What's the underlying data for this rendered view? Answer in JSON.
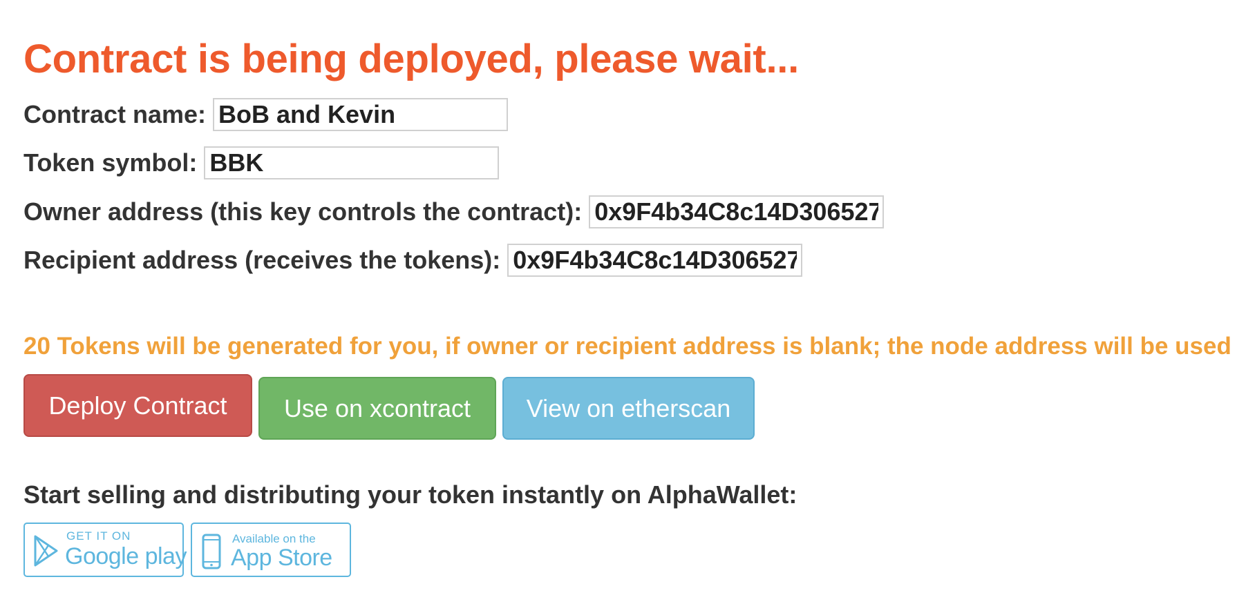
{
  "heading": "Contract is being deployed, please wait...",
  "form": {
    "contract_name_label": "Contract name:",
    "contract_name_value": "BoB and Kevin",
    "token_symbol_label": "Token symbol:",
    "token_symbol_value": "BBK",
    "owner_label": "Owner address (this key controls the contract):",
    "owner_value": "0x9F4b34C8c14D306527",
    "recipient_label": "Recipient address (receives the tokens):",
    "recipient_value": "0x9F4b34C8c14D306527"
  },
  "notice": "20 Tokens will be generated for you, if owner or recipient address is blank; the node address will be used",
  "buttons": {
    "deploy": "Deploy Contract",
    "xcontract": "Use on xcontract",
    "etherscan": "View on etherscan"
  },
  "promo": "Start selling and distributing your token instantly on AlphaWallet:",
  "badges": {
    "google_small": "GET IT ON",
    "google_big": "Google play",
    "google_icon": "play-store-icon",
    "apple_small": "Available on the",
    "apple_big": "App Store",
    "apple_icon": "phone-icon"
  },
  "colors": {
    "heading": "#ee5a2c",
    "notice": "#f0a13a",
    "deploy": "#cf5a55",
    "xcontract": "#71b767",
    "etherscan": "#77c0df",
    "badge": "#5db6de"
  }
}
